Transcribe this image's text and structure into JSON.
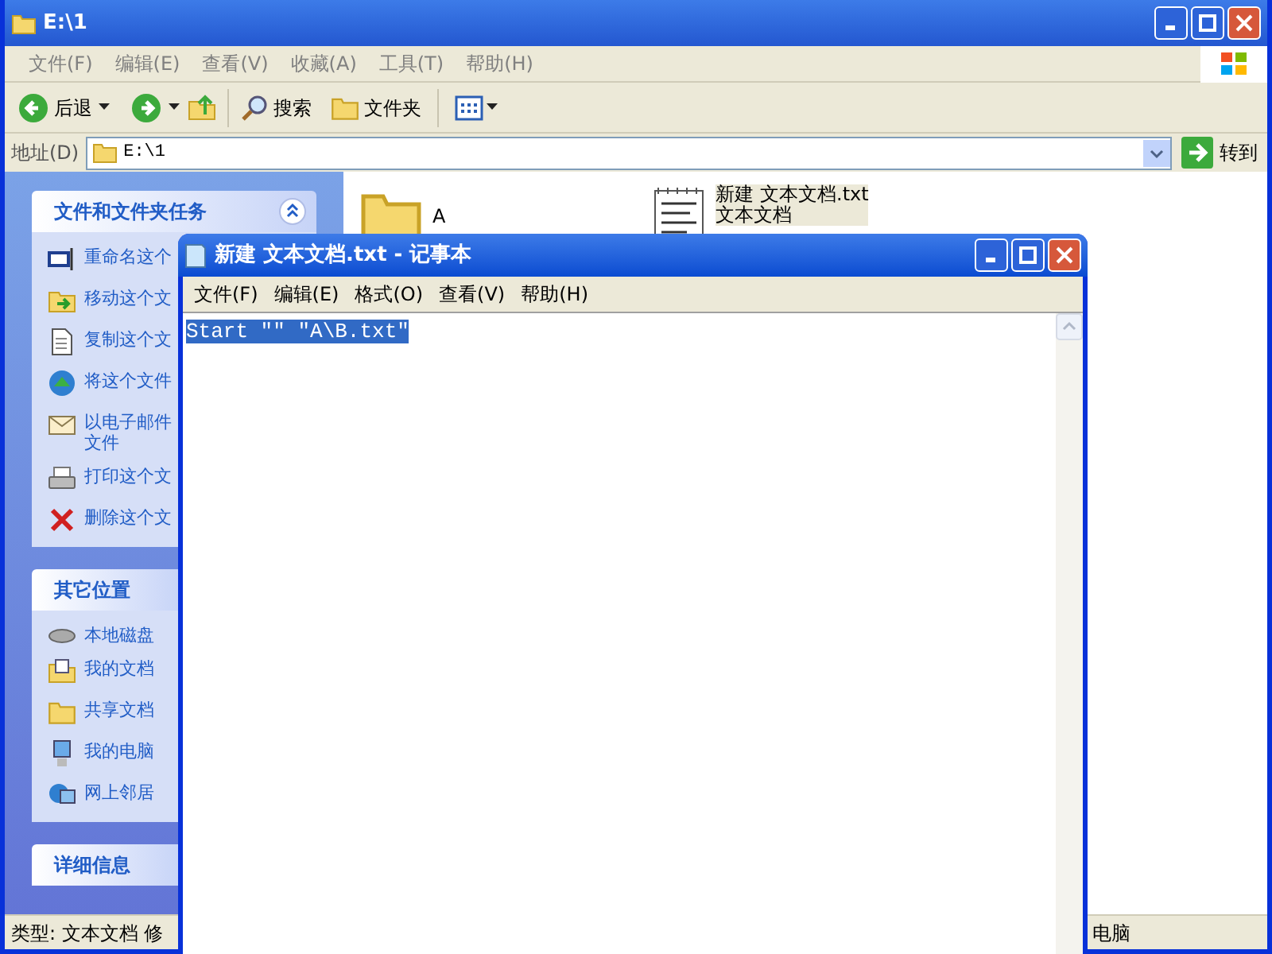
{
  "explorer": {
    "title": "E:\\1",
    "menu": [
      "文件(F)",
      "编辑(E)",
      "查看(V)",
      "收藏(A)",
      "工具(T)",
      "帮助(H)"
    ],
    "toolbar": {
      "back": "后退",
      "search": "搜索",
      "folders": "文件夹"
    },
    "address": {
      "label": "地址(D)",
      "value": "E:\\1",
      "go": "转到"
    },
    "tasks": {
      "title": "文件和文件夹任务",
      "expanded": true,
      "items": [
        {
          "kind": "rename",
          "label": "重命名这个"
        },
        {
          "kind": "move",
          "label": "移动这个文"
        },
        {
          "kind": "copy",
          "label": "复制这个文"
        },
        {
          "kind": "publish",
          "label": "将这个文件"
        },
        {
          "kind": "email",
          "lines": [
            "以电子邮件",
            "文件"
          ]
        },
        {
          "kind": "print",
          "label": "打印这个文"
        },
        {
          "kind": "delete",
          "label": "删除这个文"
        }
      ]
    },
    "other_places": {
      "title": "其它位置",
      "items": [
        {
          "kind": "disk",
          "label": "本地磁盘"
        },
        {
          "kind": "documents",
          "label": "我的文档"
        },
        {
          "kind": "folder",
          "label": "共享文档"
        },
        {
          "kind": "computer",
          "label": "我的电脑"
        },
        {
          "kind": "network",
          "label": "网上邻居"
        }
      ]
    },
    "details": {
      "title": "详细信息"
    },
    "files": [
      {
        "kind": "folder",
        "name": "A",
        "selected": false
      },
      {
        "kind": "text",
        "name": "新建 文本文档.txt",
        "type": "文本文档",
        "selected": true
      }
    ],
    "status_bar": {
      "left": "类型: 文本文档 修",
      "right": "电脑"
    }
  },
  "notepad": {
    "title": "新建 文本文档.txt - 记事本",
    "menu": [
      "文件(F)",
      "编辑(E)",
      "格式(O)",
      "查看(V)",
      "帮助(H)"
    ],
    "text": "Start \"\" \"A\\B.txt\"",
    "text_selected": true
  }
}
